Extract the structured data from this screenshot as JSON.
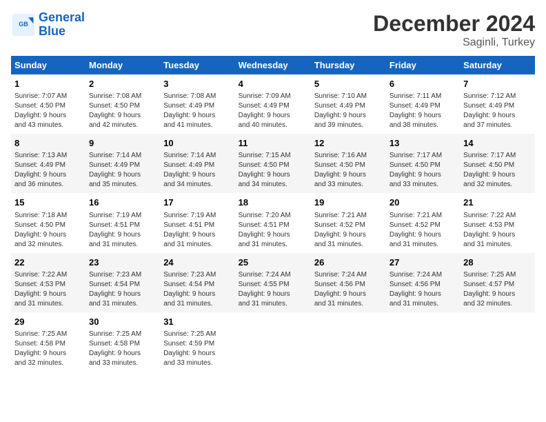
{
  "header": {
    "logo_line1": "General",
    "logo_line2": "Blue",
    "title": "December 2024",
    "subtitle": "Saginli, Turkey"
  },
  "days_of_week": [
    "Sunday",
    "Monday",
    "Tuesday",
    "Wednesday",
    "Thursday",
    "Friday",
    "Saturday"
  ],
  "weeks": [
    [
      {
        "day": "1",
        "info": "Sunrise: 7:07 AM\nSunset: 4:50 PM\nDaylight: 9 hours\nand 43 minutes."
      },
      {
        "day": "2",
        "info": "Sunrise: 7:08 AM\nSunset: 4:50 PM\nDaylight: 9 hours\nand 42 minutes."
      },
      {
        "day": "3",
        "info": "Sunrise: 7:08 AM\nSunset: 4:49 PM\nDaylight: 9 hours\nand 41 minutes."
      },
      {
        "day": "4",
        "info": "Sunrise: 7:09 AM\nSunset: 4:49 PM\nDaylight: 9 hours\nand 40 minutes."
      },
      {
        "day": "5",
        "info": "Sunrise: 7:10 AM\nSunset: 4:49 PM\nDaylight: 9 hours\nand 39 minutes."
      },
      {
        "day": "6",
        "info": "Sunrise: 7:11 AM\nSunset: 4:49 PM\nDaylight: 9 hours\nand 38 minutes."
      },
      {
        "day": "7",
        "info": "Sunrise: 7:12 AM\nSunset: 4:49 PM\nDaylight: 9 hours\nand 37 minutes."
      }
    ],
    [
      {
        "day": "8",
        "info": "Sunrise: 7:13 AM\nSunset: 4:49 PM\nDaylight: 9 hours\nand 36 minutes."
      },
      {
        "day": "9",
        "info": "Sunrise: 7:14 AM\nSunset: 4:49 PM\nDaylight: 9 hours\nand 35 minutes."
      },
      {
        "day": "10",
        "info": "Sunrise: 7:14 AM\nSunset: 4:49 PM\nDaylight: 9 hours\nand 34 minutes."
      },
      {
        "day": "11",
        "info": "Sunrise: 7:15 AM\nSunset: 4:50 PM\nDaylight: 9 hours\nand 34 minutes."
      },
      {
        "day": "12",
        "info": "Sunrise: 7:16 AM\nSunset: 4:50 PM\nDaylight: 9 hours\nand 33 minutes."
      },
      {
        "day": "13",
        "info": "Sunrise: 7:17 AM\nSunset: 4:50 PM\nDaylight: 9 hours\nand 33 minutes."
      },
      {
        "day": "14",
        "info": "Sunrise: 7:17 AM\nSunset: 4:50 PM\nDaylight: 9 hours\nand 32 minutes."
      }
    ],
    [
      {
        "day": "15",
        "info": "Sunrise: 7:18 AM\nSunset: 4:50 PM\nDaylight: 9 hours\nand 32 minutes."
      },
      {
        "day": "16",
        "info": "Sunrise: 7:19 AM\nSunset: 4:51 PM\nDaylight: 9 hours\nand 31 minutes."
      },
      {
        "day": "17",
        "info": "Sunrise: 7:19 AM\nSunset: 4:51 PM\nDaylight: 9 hours\nand 31 minutes."
      },
      {
        "day": "18",
        "info": "Sunrise: 7:20 AM\nSunset: 4:51 PM\nDaylight: 9 hours\nand 31 minutes."
      },
      {
        "day": "19",
        "info": "Sunrise: 7:21 AM\nSunset: 4:52 PM\nDaylight: 9 hours\nand 31 minutes."
      },
      {
        "day": "20",
        "info": "Sunrise: 7:21 AM\nSunset: 4:52 PM\nDaylight: 9 hours\nand 31 minutes."
      },
      {
        "day": "21",
        "info": "Sunrise: 7:22 AM\nSunset: 4:53 PM\nDaylight: 9 hours\nand 31 minutes."
      }
    ],
    [
      {
        "day": "22",
        "info": "Sunrise: 7:22 AM\nSunset: 4:53 PM\nDaylight: 9 hours\nand 31 minutes."
      },
      {
        "day": "23",
        "info": "Sunrise: 7:23 AM\nSunset: 4:54 PM\nDaylight: 9 hours\nand 31 minutes."
      },
      {
        "day": "24",
        "info": "Sunrise: 7:23 AM\nSunset: 4:54 PM\nDaylight: 9 hours\nand 31 minutes."
      },
      {
        "day": "25",
        "info": "Sunrise: 7:24 AM\nSunset: 4:55 PM\nDaylight: 9 hours\nand 31 minutes."
      },
      {
        "day": "26",
        "info": "Sunrise: 7:24 AM\nSunset: 4:56 PM\nDaylight: 9 hours\nand 31 minutes."
      },
      {
        "day": "27",
        "info": "Sunrise: 7:24 AM\nSunset: 4:56 PM\nDaylight: 9 hours\nand 31 minutes."
      },
      {
        "day": "28",
        "info": "Sunrise: 7:25 AM\nSunset: 4:57 PM\nDaylight: 9 hours\nand 32 minutes."
      }
    ],
    [
      {
        "day": "29",
        "info": "Sunrise: 7:25 AM\nSunset: 4:58 PM\nDaylight: 9 hours\nand 32 minutes."
      },
      {
        "day": "30",
        "info": "Sunrise: 7:25 AM\nSunset: 4:58 PM\nDaylight: 9 hours\nand 33 minutes."
      },
      {
        "day": "31",
        "info": "Sunrise: 7:25 AM\nSunset: 4:59 PM\nDaylight: 9 hours\nand 33 minutes."
      },
      {
        "day": "",
        "info": ""
      },
      {
        "day": "",
        "info": ""
      },
      {
        "day": "",
        "info": ""
      },
      {
        "day": "",
        "info": ""
      }
    ]
  ]
}
